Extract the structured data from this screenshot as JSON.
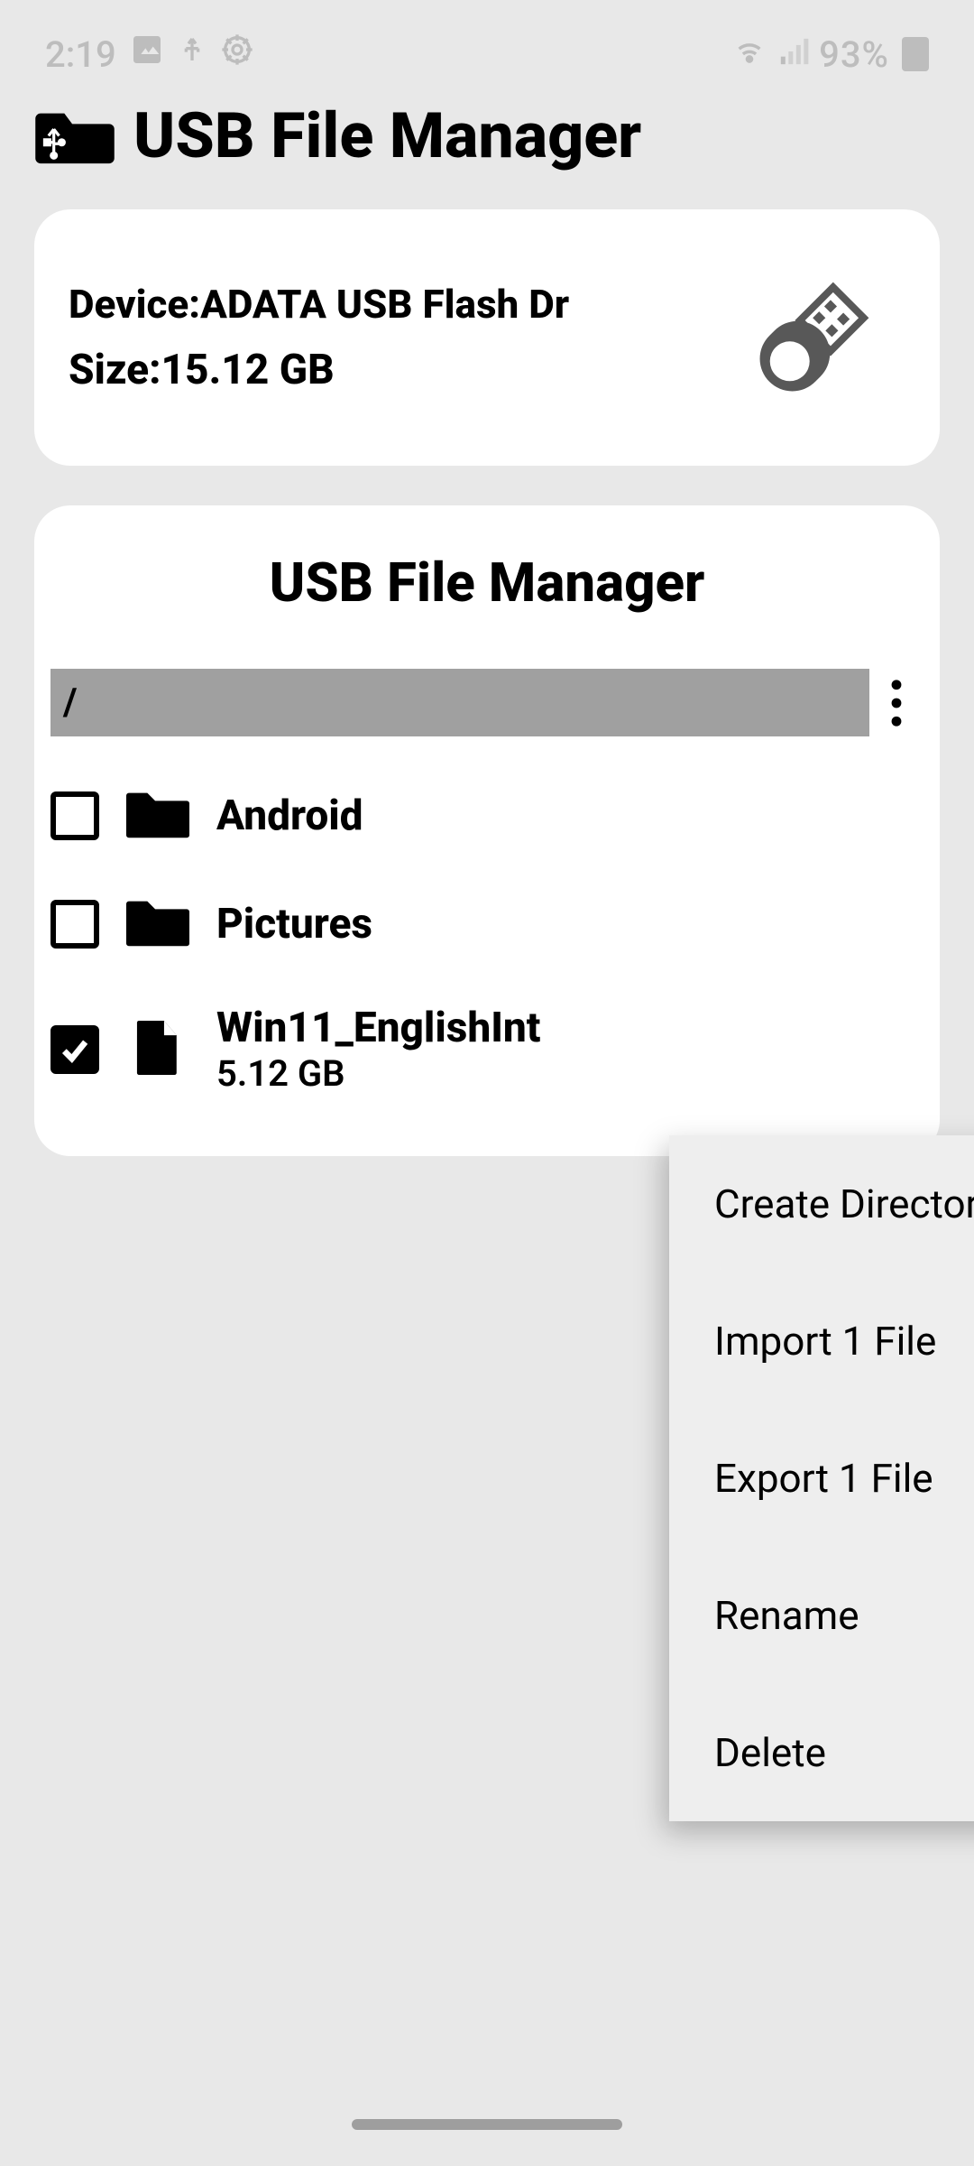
{
  "statusbar": {
    "time": "2:19",
    "battery": "93%"
  },
  "app_title": "USB File Manager",
  "device": {
    "label_prefix": "Device:",
    "name": "ADATA USB Flash Dr",
    "size_prefix": "Size:",
    "size": "15.12 GB"
  },
  "panel_title": "USB File Manager",
  "path": "/",
  "files": [
    {
      "name": "Android",
      "type": "folder",
      "checked": false
    },
    {
      "name": "Pictures",
      "type": "folder",
      "checked": false
    },
    {
      "name": "Win11_EnglishInt",
      "type": "file",
      "size": "5.12 GB",
      "checked": true
    }
  ],
  "menu": {
    "create_dir": "Create Directory",
    "import": "Import 1 File",
    "export": "Export 1 File",
    "rename": "Rename",
    "delete": "Delete"
  }
}
